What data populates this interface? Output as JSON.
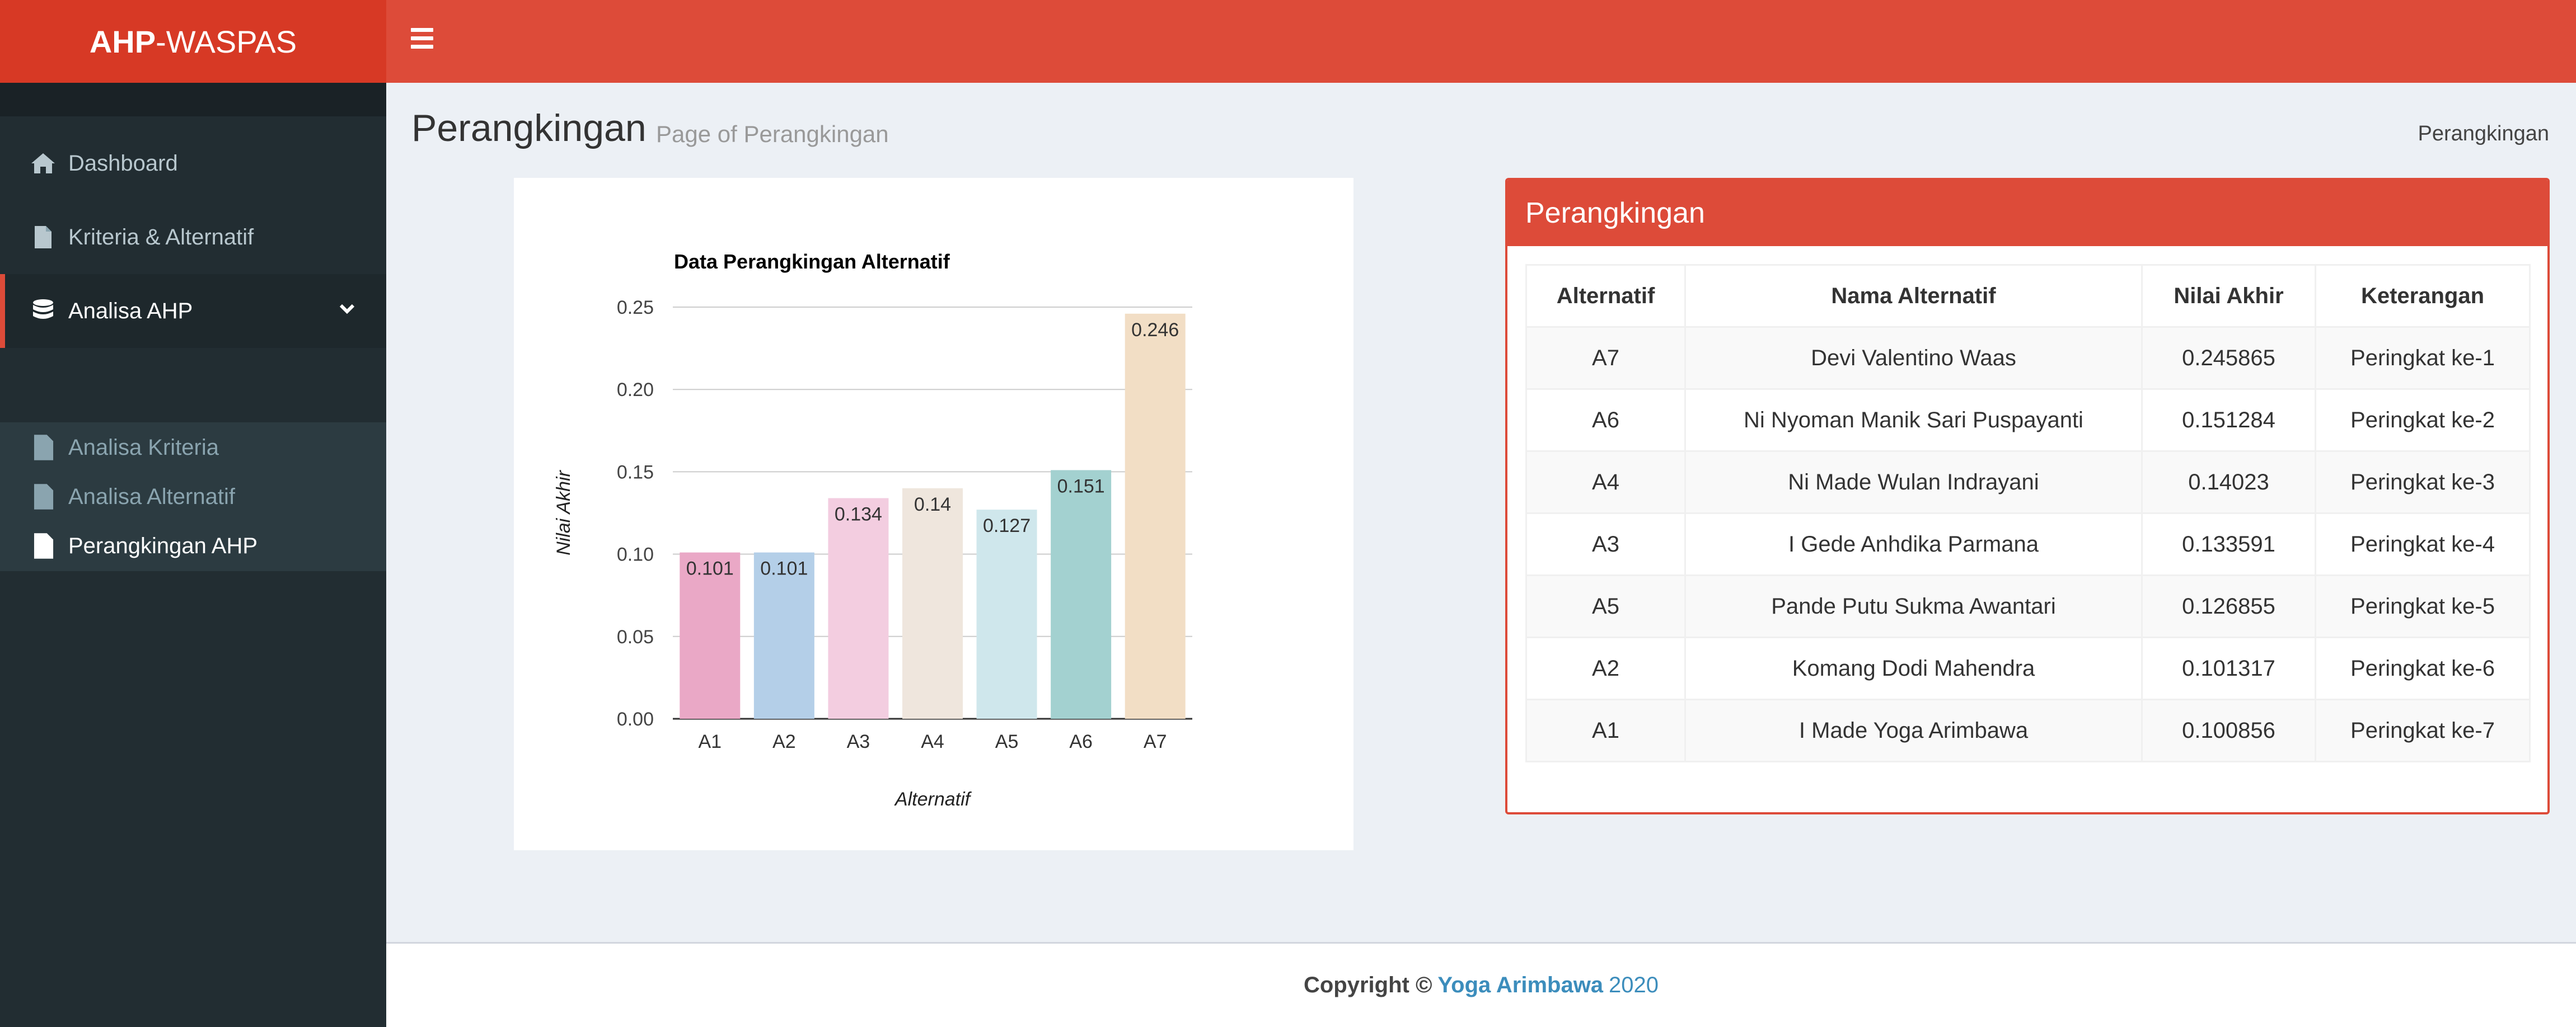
{
  "app": {
    "title_bold": "AHP",
    "title_rest": "-WASPAS"
  },
  "sidebar": {
    "items": [
      {
        "label": "Dashboard",
        "icon": "home-icon"
      },
      {
        "label": "Kriteria & Alternatif",
        "icon": "file-icon"
      },
      {
        "label": "Analisa AHP",
        "icon": "database-icon"
      }
    ],
    "submenu": [
      {
        "label": "Analisa Kriteria",
        "icon": "file-icon"
      },
      {
        "label": "Analisa Alternatif",
        "icon": "file-icon"
      },
      {
        "label": "Perangkingan AHP",
        "icon": "file-icon"
      }
    ]
  },
  "header": {
    "title": "Perangkingan",
    "subtitle": "Page of Perangkingan",
    "breadcrumb": "Perangkingan"
  },
  "chart_data": {
    "type": "bar",
    "title": "Data Perangkingan Alternatif",
    "xlabel": "Alternatif",
    "ylabel": "Nilai Akhir",
    "categories": [
      "A1",
      "A2",
      "A3",
      "A4",
      "A5",
      "A6",
      "A7"
    ],
    "values": [
      0.101,
      0.101,
      0.134,
      0.14,
      0.127,
      0.151,
      0.246
    ],
    "ylim": [
      0,
      0.25
    ],
    "yticks": [
      "0.00",
      "0.05",
      "0.10",
      "0.15",
      "0.20",
      "0.25"
    ],
    "colors": [
      "#eaa8c6",
      "#b4cfe8",
      "#f3cde0",
      "#efe6dd",
      "#cfe7ec",
      "#a3d1d0",
      "#f2dec5"
    ],
    "grid": true
  },
  "table": {
    "title": "Perangkingan",
    "headers": [
      "Alternatif",
      "Nama Alternatif",
      "Nilai Akhir",
      "Keterangan"
    ],
    "rows": [
      [
        "A7",
        "Devi Valentino Waas",
        "0.245865",
        "Peringkat ke-1"
      ],
      [
        "A6",
        "Ni Nyoman Manik Sari Puspayanti",
        "0.151284",
        "Peringkat ke-2"
      ],
      [
        "A4",
        "Ni Made Wulan Indrayani",
        "0.14023",
        "Peringkat ke-3"
      ],
      [
        "A3",
        "I Gede Anhdika Parmana",
        "0.133591",
        "Peringkat ke-4"
      ],
      [
        "A5",
        "Pande Putu Sukma Awantari",
        "0.126855",
        "Peringkat ke-5"
      ],
      [
        "A2",
        "Komang Dodi Mahendra",
        "0.101317",
        "Peringkat ke-6"
      ],
      [
        "A1",
        "I Made Yoga Arimbawa",
        "0.100856",
        "Peringkat ke-7"
      ]
    ]
  },
  "footer": {
    "prefix": "Copyright ©",
    "author": "Yoga Arimbawa",
    "year": "2020"
  },
  "colors": {
    "brand_red": "#dd4b39",
    "brand_red_dark": "#d73925",
    "sidebar_bg": "#222d32",
    "link_blue": "#3c8dbc"
  }
}
